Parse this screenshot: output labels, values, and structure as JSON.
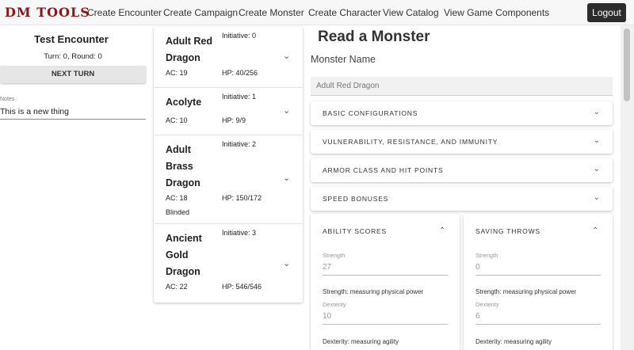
{
  "nav": {
    "brand": "DM TOOLS",
    "links": [
      "Create Encounter",
      "Create Campaign",
      "Create Monster",
      "Create Character",
      "View Catalog",
      "View Game Components"
    ],
    "logout": "Logout"
  },
  "encounter": {
    "title": "Test Encounter",
    "turn_text": "Turn: 0, Round: 0",
    "next_turn": "NEXT TURN",
    "notes_label": "Notes",
    "notes_value": "This is a new thing"
  },
  "creatures": [
    {
      "name": "Adult Red Dragon",
      "initiative": "Initiative: 0",
      "ac": "AC: 19",
      "hp": "HP: 40/256",
      "condition": ""
    },
    {
      "name": "Acolyte",
      "initiative": "Initiative: 1",
      "ac": "AC: 10",
      "hp": "HP: 9/9",
      "condition": ""
    },
    {
      "name": "Adult Brass Dragon",
      "initiative": "Initiative: 2",
      "ac": "AC: 18",
      "hp": "HP: 150/172",
      "condition": "Blinded"
    },
    {
      "name": "Ancient Gold Dragon",
      "initiative": "Initiative: 3",
      "ac": "AC: 22",
      "hp": "HP: 546/546",
      "condition": ""
    }
  ],
  "main": {
    "title": "Read a Monster",
    "name_label": "Monster Name",
    "name_value": "Adult Red Dragon",
    "sections": [
      "BASIC CONFIGURATIONS",
      "VULNERABILITY, RESISTANCE, AND IMMUNITY",
      "ARMOR CLASS AND HIT POINTS",
      "SPEED BONUSES"
    ],
    "ability_scores": {
      "title": "ABILITY SCORES",
      "strength_label": "Strength",
      "strength_value": "27",
      "strength_desc": "Strength: measuring physical power",
      "dexterity_label": "Dexterity",
      "dexterity_value": "10",
      "dexterity_desc": "Dexterity: measuring agility"
    },
    "saving_throws": {
      "title": "SAVING THROWS",
      "strength_label": "Strength",
      "strength_value": "0",
      "strength_desc": "Strength: measuring physical power",
      "dexterity_label": "Dexterity",
      "dexterity_value": "6",
      "dexterity_desc": "Dexterity: measuring agility"
    }
  },
  "icons": {
    "chevron_down": "chevron-down-icon",
    "chevron_up": "chevron-up-icon"
  },
  "colors": {
    "brand": "#8b1515",
    "logout_bg": "#2c2c2c"
  }
}
